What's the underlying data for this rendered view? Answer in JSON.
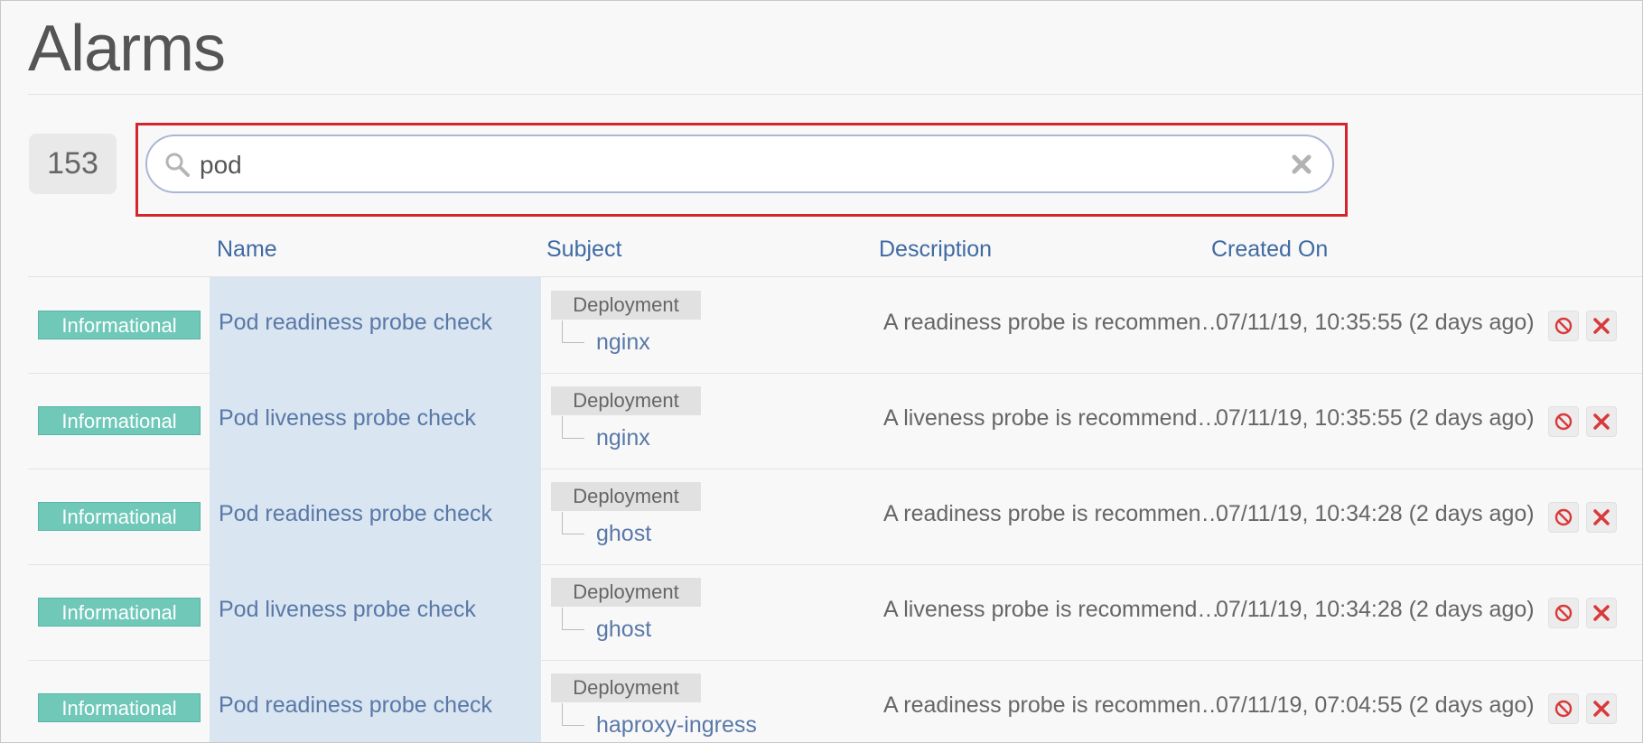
{
  "page": {
    "title": "Alarms"
  },
  "count": "153",
  "search": {
    "value": "pod",
    "placeholder": ""
  },
  "columns": {
    "name": "Name",
    "subject": "Subject",
    "description": "Description",
    "created_on": "Created On"
  },
  "rows": [
    {
      "severity": "Informational",
      "name": "Pod readiness probe check",
      "subject_type": "Deployment",
      "subject_name": "nginx",
      "description": "A readiness probe is recommended to ensure traffic only goes to a fully initialized pod.",
      "created": "07/11/19, 10:35:55 (2 days ago)"
    },
    {
      "severity": "Informational",
      "name": "Pod liveness probe check",
      "subject_type": "Deployment",
      "subject_name": "nginx",
      "description": "A liveness probe is recommended to ensure that your pod is automatically restarted.",
      "created": "07/11/19, 10:35:55 (2 days ago)"
    },
    {
      "severity": "Informational",
      "name": "Pod readiness probe check",
      "subject_type": "Deployment",
      "subject_name": "ghost",
      "description": "A readiness probe is recommended to ensure traffic only goes to a fully initialized pod.",
      "created": "07/11/19, 10:34:28 (2 days ago)"
    },
    {
      "severity": "Informational",
      "name": "Pod liveness probe check",
      "subject_type": "Deployment",
      "subject_name": "ghost",
      "description": "A liveness probe is recommended to ensure that your pod is automatically restarted.",
      "created": "07/11/19, 10:34:28 (2 days ago)"
    },
    {
      "severity": "Informational",
      "name": "Pod readiness probe check",
      "subject_type": "Deployment",
      "subject_name": "haproxy-ingress",
      "description": "A readiness probe is recommended to ensure traffic only goes to a fully initialized pod.",
      "created": "07/11/19, 07:04:55 (2 days ago)"
    }
  ],
  "colors": {
    "accent": "#3f6aa3",
    "informational": "#6fc8b8",
    "danger": "#d9393b",
    "name_cell_bg": "#d9e5f0",
    "highlight": "#d4242c"
  },
  "icons": {
    "search": "search-icon",
    "clear": "close-icon",
    "ignore": "ban-icon",
    "delete": "x-icon"
  }
}
